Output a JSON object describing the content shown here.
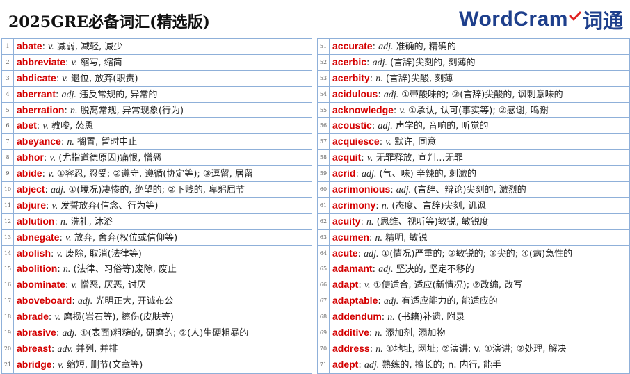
{
  "header": {
    "title": "2025GRE必备词汇(精选版)",
    "logo_text": "WordCram",
    "logo_cn": "词通",
    "brand_color": "#1e3f8c",
    "accent_color": "#e02020"
  },
  "left_rows": [
    {
      "num": "1",
      "word": "abate",
      "pos": "v.",
      "def": "减弱, 减轻, 减少"
    },
    {
      "num": "2",
      "word": "abbreviate",
      "pos": "v.",
      "def": "缩写, 缩简"
    },
    {
      "num": "3",
      "word": "abdicate",
      "pos": "v.",
      "def": "退位, 放弃(职责)"
    },
    {
      "num": "4",
      "word": "aberrant",
      "pos": "adj.",
      "def": "违反常规的, 异常的"
    },
    {
      "num": "5",
      "word": "aberration",
      "pos": "n.",
      "def": "脱离常规, 异常现象(行为)"
    },
    {
      "num": "6",
      "word": "abet",
      "pos": "v.",
      "def": "教唆, 怂恿"
    },
    {
      "num": "7",
      "word": "abeyance",
      "pos": "n.",
      "def": "搁置, 暂时中止"
    },
    {
      "num": "8",
      "word": "abhor",
      "pos": "v.",
      "def": "(尤指道德原因)痛恨, 憎恶"
    },
    {
      "num": "9",
      "word": "abide",
      "pos": "v.",
      "def": "①容忍, 忍受; ②遵守, 遵循(协定等); ③逗留, 居留"
    },
    {
      "num": "10",
      "word": "abject",
      "pos": "adj.",
      "def": "①(境况)凄惨的, 绝望的; ②下贱的, 卑躬屈节"
    },
    {
      "num": "11",
      "word": "abjure",
      "pos": "v.",
      "def": "发誓放弃(信念、行为等)"
    },
    {
      "num": "12",
      "word": "ablution",
      "pos": "n.",
      "def": "洗礼, 沐浴"
    },
    {
      "num": "13",
      "word": "abnegate",
      "pos": "v.",
      "def": "放弃, 舍弃(权位或信仰等)"
    },
    {
      "num": "14",
      "word": "abolish",
      "pos": "v.",
      "def": "废除, 取消(法律等)"
    },
    {
      "num": "15",
      "word": "abolition",
      "pos": "n.",
      "def": "(法律、习俗等)废除, 废止"
    },
    {
      "num": "16",
      "word": "abominate",
      "pos": "v.",
      "def": "憎恶, 厌恶, 讨厌"
    },
    {
      "num": "17",
      "word": "aboveboard",
      "pos": "adj.",
      "def": "光明正大, 开诚布公"
    },
    {
      "num": "18",
      "word": "abrade",
      "pos": "v.",
      "def": "磨损(岩石等), 擦伤(皮肤等)"
    },
    {
      "num": "19",
      "word": "abrasive",
      "pos": "adj.",
      "def": "①(表面)粗糙的, 研磨的; ②(人)生硬粗暴的"
    },
    {
      "num": "20",
      "word": "abreast",
      "pos": "adv.",
      "def": "并列, 并排"
    },
    {
      "num": "21",
      "word": "abridge",
      "pos": "v.",
      "def": "缩短, 删节(文章等)"
    }
  ],
  "right_rows": [
    {
      "num": "51",
      "word": "accurate",
      "pos": "adj.",
      "def": "准确的, 精确的"
    },
    {
      "num": "52",
      "word": "acerbic",
      "pos": "adj.",
      "def": "(言辞)尖刻的, 刻薄的"
    },
    {
      "num": "53",
      "word": "acerbity",
      "pos": "n.",
      "def": "(言辞)尖酸, 刻薄"
    },
    {
      "num": "54",
      "word": "acidulous",
      "pos": "adj.",
      "def": "①带酸味的; ②(言辞)尖酸的, 讽刺意味的"
    },
    {
      "num": "55",
      "word": "acknowledge",
      "pos": "v.",
      "def": "①承认, 认可(事实等); ②感谢, 鸣谢"
    },
    {
      "num": "56",
      "word": "acoustic",
      "pos": "adj.",
      "def": "声学的, 音响的, 听觉的"
    },
    {
      "num": "57",
      "word": "acquiesce",
      "pos": "v.",
      "def": "默许, 同意"
    },
    {
      "num": "58",
      "word": "acquit",
      "pos": "v.",
      "def": "无罪释放, 宣判…无罪"
    },
    {
      "num": "59",
      "word": "acrid",
      "pos": "adj.",
      "def": "(气、味) 辛辣的, 刺激的"
    },
    {
      "num": "60",
      "word": "acrimonious",
      "pos": "adj.",
      "def": "(言辞、辩论)尖刻的, 激烈的"
    },
    {
      "num": "61",
      "word": "acrimony",
      "pos": "n.",
      "def": "(态度、言辞)尖刻, 讥讽"
    },
    {
      "num": "62",
      "word": "acuity",
      "pos": "n.",
      "def": "(思维、视听等)敏锐, 敏锐度"
    },
    {
      "num": "63",
      "word": "acumen",
      "pos": "n.",
      "def": "精明, 敏锐"
    },
    {
      "num": "64",
      "word": "acute",
      "pos": "adj.",
      "def": "①(情况)严重的; ②敏锐的; ③尖的; ④(病)急性的"
    },
    {
      "num": "65",
      "word": "adamant",
      "pos": "adj.",
      "def": "坚决的, 坚定不移的"
    },
    {
      "num": "66",
      "word": "adapt",
      "pos": "v.",
      "def": "①使适合, 适应(新情况); ②改编, 改写"
    },
    {
      "num": "67",
      "word": "adaptable",
      "pos": "adj.",
      "def": "有适应能力的, 能适应的"
    },
    {
      "num": "68",
      "word": "addendum",
      "pos": "n.",
      "def": "(书籍)补遗, 附录"
    },
    {
      "num": "69",
      "word": "additive",
      "pos": "n.",
      "def": "添加剂, 添加物"
    },
    {
      "num": "70",
      "word": "address",
      "pos": "n.",
      "def": "①地址, 网址; ②演讲; v. ①演讲; ②处理, 解决"
    },
    {
      "num": "71",
      "word": "adept",
      "pos": "adj.",
      "def": "熟练的, 擅长的; n. 内行, 能手"
    }
  ]
}
